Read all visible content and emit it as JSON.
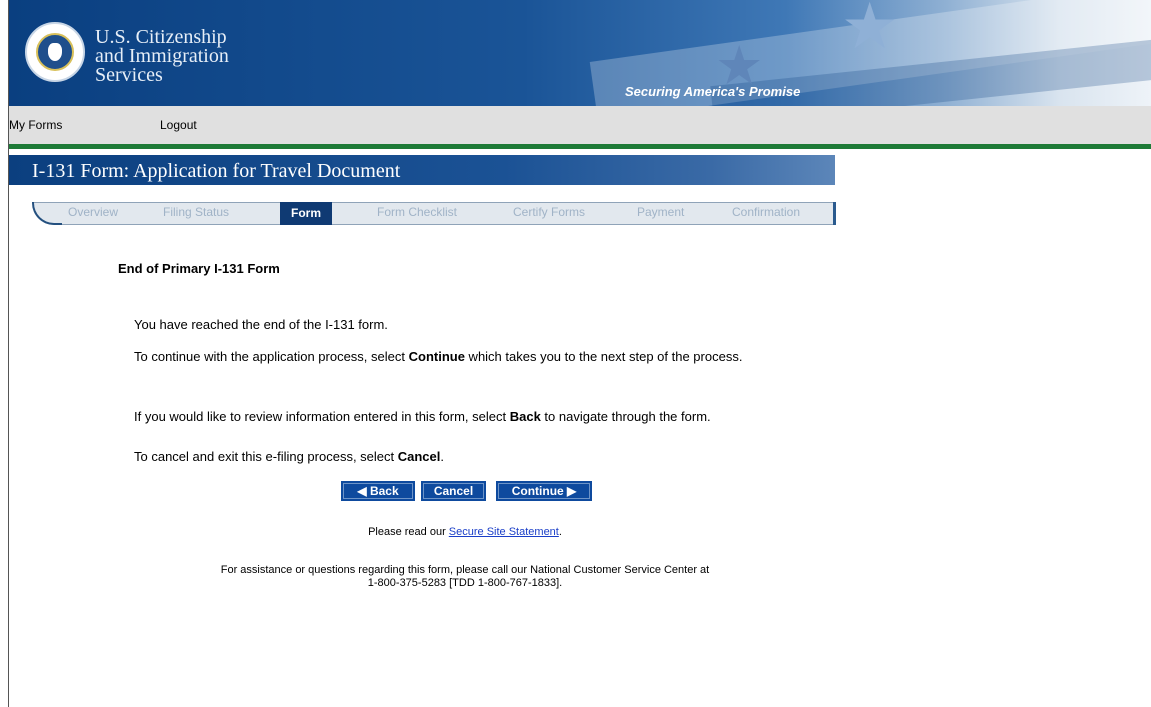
{
  "header": {
    "agency_line1": "U.S. Citizenship",
    "agency_line2": "and Immigration",
    "agency_line3": "Services",
    "tagline": "Securing America's Promise",
    "seal_icon": "dhs-seal-icon"
  },
  "nav": {
    "my_forms": "My Forms",
    "logout": "Logout"
  },
  "form_title": "I-131 Form: Application for Travel Document",
  "tabs": [
    {
      "label": "Overview",
      "active": false
    },
    {
      "label": "Filing Status",
      "active": false
    },
    {
      "label": "Form",
      "active": true
    },
    {
      "label": "Form Checklist",
      "active": false
    },
    {
      "label": "Certify Forms",
      "active": false
    },
    {
      "label": "Payment",
      "active": false
    },
    {
      "label": "Confirmation",
      "active": false
    }
  ],
  "content": {
    "heading": "End of Primary I-131 Form",
    "p1": "You have reached the end of the I-131 form.",
    "p2_pre": "To continue with the application process, select ",
    "p2_bold": "Continue",
    "p2_post": " which takes you to the next step of the process.",
    "p3_pre": "If you would like to review information entered in this form, select ",
    "p3_bold": "Back",
    "p3_post": " to navigate through the form.",
    "p4_pre": "To cancel and exit this e-filing process, select ",
    "p4_bold": "Cancel",
    "p4_post": "."
  },
  "buttons": {
    "back": "◀ Back",
    "cancel": "Cancel",
    "continue": "Continue ▶"
  },
  "footer": {
    "secure_pre": "Please read our ",
    "secure_link": "Secure Site Statement",
    "secure_post": ".",
    "assist_line1": "For assistance or questions regarding this form, please call our National Customer Service Center at",
    "assist_line2": "1-800-375-5283 [TDD 1-800-767-1833]."
  },
  "colors": {
    "banner_blue": "#0a3f80",
    "nav_green": "#1e7a37",
    "button_blue": "#0e4a9e",
    "link_blue": "#1a3ec8"
  }
}
